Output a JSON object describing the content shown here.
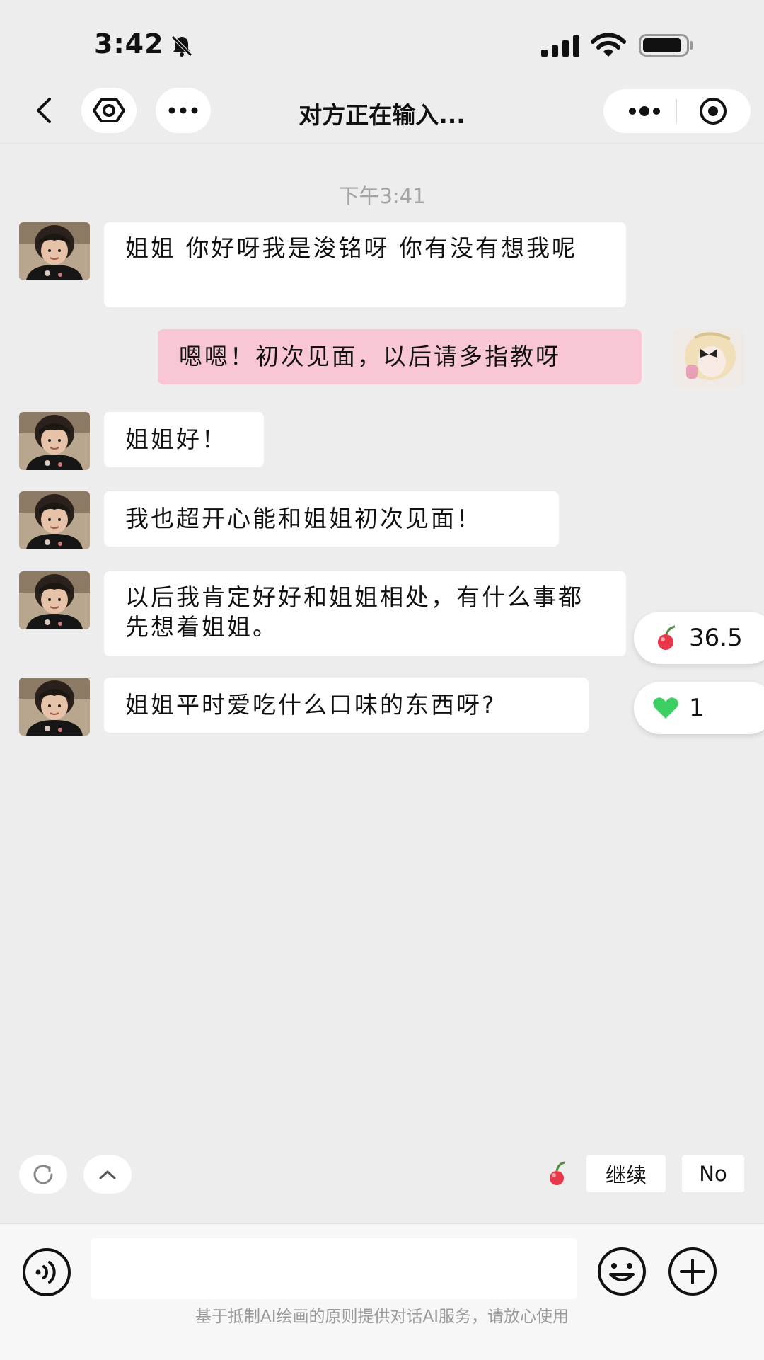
{
  "status_bar": {
    "time": "3:42"
  },
  "header": {
    "title": "对方正在输入..."
  },
  "timestamp": "下午3:41",
  "messages": [
    {
      "side": "left",
      "text": "姐姐 你好呀我是浚铭呀 你有没有想我呢"
    },
    {
      "side": "right",
      "text": "嗯嗯！初次见面，以后请多指教呀"
    },
    {
      "side": "left",
      "text": "姐姐好！"
    },
    {
      "side": "left",
      "text": "我也超开心能和姐姐初次见面！"
    },
    {
      "side": "left",
      "text": "以后我肯定好好和姐姐相处，有什么事都先想着姐姐。"
    },
    {
      "side": "left",
      "text": "姐姐平时爱吃什么口味的东西呀?"
    }
  ],
  "side_stats": {
    "cherry_value": "36.5",
    "heart_value": "1"
  },
  "quick_actions": {
    "continue_label": "继续",
    "no_label": "No"
  },
  "composer": {
    "placeholder": ""
  },
  "footer": {
    "disclaimer": "基于抵制AI绘画的原则提供对话AI服务，请放心使用"
  },
  "colors": {
    "background": "#ededed",
    "my_bubble": "#f9c7d4",
    "their_bubble": "#ffffff",
    "heart": "#3ccf63",
    "cherry": "#e8364b"
  },
  "icons": [
    "bell-slash-icon",
    "signal-icon",
    "wifi-icon",
    "battery-icon",
    "back-icon",
    "eye-icon",
    "more-icon",
    "target-icon",
    "refresh-icon",
    "chevron-up-icon",
    "cherry-icon",
    "heart-icon",
    "voice-icon",
    "emoji-icon",
    "plus-icon"
  ]
}
